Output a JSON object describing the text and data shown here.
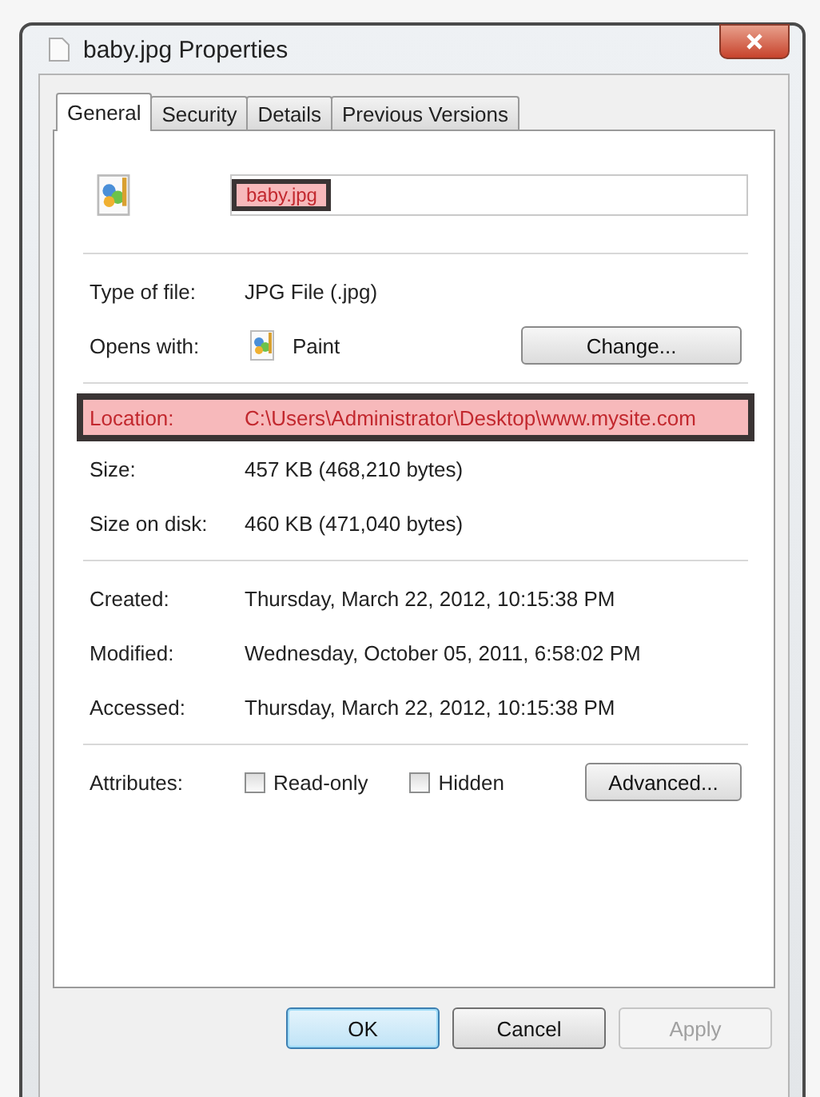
{
  "window": {
    "title": "baby.jpg Properties"
  },
  "tabs": [
    {
      "label": "General",
      "selected": true
    },
    {
      "label": "Security",
      "selected": false
    },
    {
      "label": "Details",
      "selected": false
    },
    {
      "label": "Previous Versions",
      "selected": false
    }
  ],
  "file_name": {
    "value": "baby.jpg",
    "highlighted": true
  },
  "sections": [
    [
      {
        "kind": "text",
        "label": "Type of file:",
        "value": "JPG File (.jpg)",
        "highlighted": false
      },
      {
        "kind": "app",
        "label": "Opens with:",
        "value": "Paint",
        "button": "Change...",
        "highlighted": false
      }
    ],
    [
      {
        "kind": "text",
        "label": "Location:",
        "value": "C:\\Users\\Administrator\\Desktop\\www.mysite.com",
        "highlighted": true
      },
      {
        "kind": "text",
        "label": "Size:",
        "value": "457 KB (468,210 bytes)",
        "highlighted": false
      },
      {
        "kind": "text",
        "label": "Size on disk:",
        "value": "460 KB (471,040 bytes)",
        "highlighted": false
      }
    ],
    [
      {
        "kind": "text",
        "label": "Created:",
        "value": "Thursday, March 22, 2012, 10:15:38 PM",
        "highlighted": false
      },
      {
        "kind": "text",
        "label": "Modified:",
        "value": "Wednesday, October 05, 2011, 6:58:02 PM",
        "highlighted": false
      },
      {
        "kind": "text",
        "label": "Accessed:",
        "value": "Thursday, March 22, 2012, 10:15:38 PM",
        "highlighted": false
      }
    ],
    [
      {
        "kind": "attributes",
        "label": "Attributes:",
        "checkboxes": [
          {
            "label": "Read-only",
            "checked": false
          },
          {
            "label": "Hidden",
            "checked": false
          }
        ],
        "button": "Advanced..."
      }
    ]
  ],
  "buttons": [
    {
      "label": "OK",
      "default": true,
      "disabled": false
    },
    {
      "label": "Cancel",
      "default": false,
      "disabled": false
    },
    {
      "label": "Apply",
      "default": false,
      "disabled": true
    }
  ]
}
